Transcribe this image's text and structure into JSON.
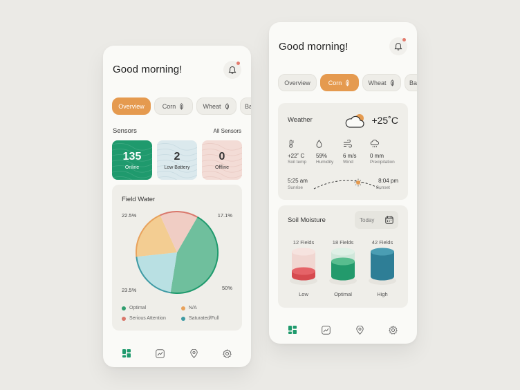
{
  "left": {
    "greeting": "Good morning!",
    "tabs": [
      {
        "label": "Overview",
        "active": true
      },
      {
        "label": "Corn",
        "active": false
      },
      {
        "label": "Wheat",
        "active": false
      },
      {
        "label": "Bar",
        "active": false
      }
    ],
    "sensors": {
      "title": "Sensors",
      "link": "All Sensors",
      "cards": [
        {
          "value": "135",
          "label": "Online"
        },
        {
          "value": "2",
          "label": "Low Battery"
        },
        {
          "value": "0",
          "label": "Offline"
        }
      ]
    },
    "field_water": {
      "title": "Field Water",
      "labels": {
        "optimal": "50%",
        "saturated": "23.5%",
        "na": "22.5%",
        "serious": "17.1%"
      },
      "legend": [
        {
          "label": "Optimal",
          "color": "#2f9d6e"
        },
        {
          "label": "N/A",
          "color": "#e8a25c"
        },
        {
          "label": "Serious Attention",
          "color": "#d9776b"
        },
        {
          "label": "Saturated/Full",
          "color": "#3e9aa4"
        }
      ]
    }
  },
  "chart_data": {
    "type": "pie",
    "title": "Field Water",
    "slices": [
      {
        "label": "Optimal",
        "value": 50,
        "color": "#6fbf9d"
      },
      {
        "label": "Saturated/Full",
        "value": 23.5,
        "color": "#b9e0e3"
      },
      {
        "label": "N/A",
        "value": 22.5,
        "color": "#f3cd92"
      },
      {
        "label": "Serious Attention",
        "value": 17.1,
        "color": "#f0cdc4"
      }
    ]
  },
  "right": {
    "greeting": "Good morning!",
    "tabs": [
      {
        "label": "Overview",
        "active": false
      },
      {
        "label": "Corn",
        "active": true
      },
      {
        "label": "Wheat",
        "active": false
      },
      {
        "label": "Bar",
        "active": false
      }
    ],
    "weather": {
      "title": "Weather",
      "temp": "+25˚C",
      "items": [
        {
          "value": "+22˚ C",
          "caption": "Soil temp"
        },
        {
          "value": "59%",
          "caption": "Humidity"
        },
        {
          "value": "6 m/s",
          "caption": "Wind"
        },
        {
          "value": "0 mm",
          "caption": "Precipitation"
        }
      ],
      "sunrise_time": "5:25 am",
      "sunrise_label": "Sunrise",
      "sunset_time": "8:04 pm",
      "sunset_label": "Sunset"
    },
    "soil": {
      "title": "Soil Moisture",
      "period": "Today",
      "columns": [
        {
          "top": "12 Fields",
          "bottom": "Low"
        },
        {
          "top": "18 Fields",
          "bottom": "Optimal"
        },
        {
          "top": "42 Fields",
          "bottom": "High"
        }
      ]
    }
  },
  "icons": {
    "bell": "bell-icon",
    "leaf": "leaf-icon",
    "dashboard": "dashboard-icon",
    "chart": "chart-icon",
    "location": "location-pin-icon",
    "settings": "gear-icon",
    "calendar": "calendar-icon"
  },
  "colors": {
    "accent": "#e59a4f",
    "green": "#1f9a6d",
    "blue_card": "#dbe9ed",
    "pink_card": "#f3dcd6"
  }
}
